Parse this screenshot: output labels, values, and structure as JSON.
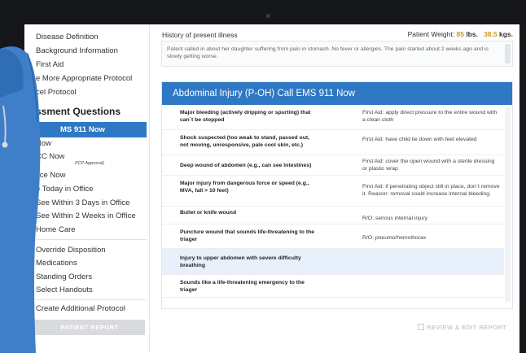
{
  "sidebar": {
    "items_top": [
      "Disease Definition",
      "Background Information",
      "First Aid",
      "e More Appropriate Protocol",
      "cel Protocol"
    ],
    "heading": "ssment Questions",
    "active_item": "MS 911 Now",
    "items_mid": [
      "Now",
      "CC Now",
      "fice Now",
      "e Today in Office",
      "See Within 3 Days in Office",
      "See Within 2 Weeks in Office",
      "Home Care"
    ],
    "sub_note": "PCP Approval)",
    "items_bottom": [
      "Override Disposition",
      "Medications",
      "Standing Orders",
      "Select Handouts"
    ],
    "create_item": "Create Additional Protocol",
    "report_button": "PATIENT REPORT"
  },
  "main": {
    "hpi_label": "History of present illness",
    "weight_label": "Patient Weight:",
    "weight_lbs": "85",
    "weight_lbs_unit": "lbs.",
    "weight_kg": "38.5",
    "weight_kg_unit": "kgs.",
    "hpi_text": "Patent called in about her daughter suffering from pain in stomach. No fever or allergies. The pain started about 2 weeks ago and is slowly getting worse.",
    "panel_title": "Abdominal Injury (P-OH)  Call EMS 911 Now",
    "rows": [
      {
        "q": "Major bleeding (actively dripping or spurting) that can`t be stopped",
        "a": "First Aid: apply direct pressure to the entire wound with a clean cloth"
      },
      {
        "q": "Shock suspected (too weak to stand, passed out, not moving, unresponsive, pale cool skin, etc.)",
        "a": "First Aid: have child lie down with feet elevated"
      },
      {
        "q": "Deep wound of abdomen (e.g., can see intestines)",
        "a": "First Aid: cover the open wound with a sterile dressing or plastic wrap"
      },
      {
        "q": "Major injury from dangerous force or speed (e.g., MVA, fall > 10 feet)",
        "a": "First Aid: if penetrating object still in place, don`t remove it. Reason: removal could increase internal bleeding."
      },
      {
        "q": "Bullet or knife wound",
        "a": "R/O: serious internal injury"
      },
      {
        "q": "Puncture wound that sounds life-threatening to the triager",
        "a": "R/O: pneumo/hemothorax"
      },
      {
        "q": "Injury to upper abdomen with severe difficulty breathing",
        "a": ""
      },
      {
        "q": "Sounds like a life-threatening emergency to the triager",
        "a": ""
      }
    ],
    "review_button": "REVIEW & EDIT REPORT"
  },
  "colors": {
    "accent": "#2f78c4",
    "weight": "#c69a2b",
    "scrubs": "#3f7fc9"
  },
  "icons": [
    "edit-icon",
    "camera-icon"
  ]
}
